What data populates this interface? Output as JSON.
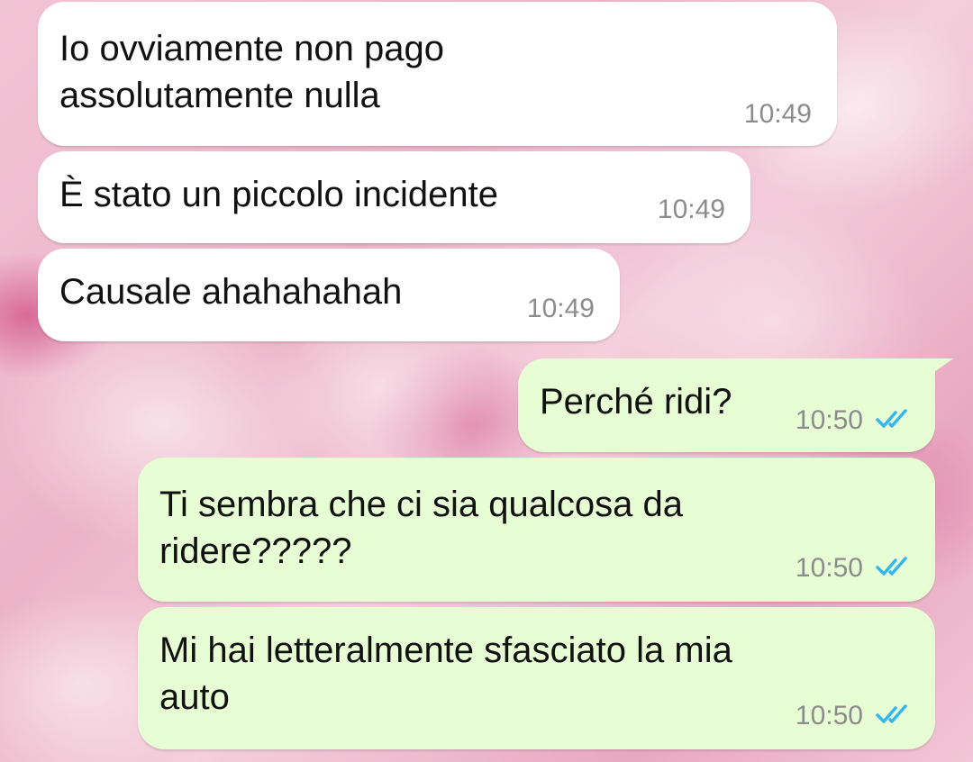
{
  "chat": {
    "messages": [
      {
        "direction": "incoming",
        "lines": [
          "Io ovviamente non pago",
          "assolutamente nulla"
        ],
        "time": "10:49"
      },
      {
        "direction": "incoming",
        "lines": [
          "È stato un piccolo incidente"
        ],
        "time": "10:49"
      },
      {
        "direction": "incoming",
        "lines": [
          "Causale ahahahahah"
        ],
        "time": "10:49"
      },
      {
        "direction": "outgoing",
        "lines": [
          "Perché ridi?"
        ],
        "time": "10:50",
        "status": "read"
      },
      {
        "direction": "outgoing",
        "lines": [
          "Ti sembra che ci sia qualcosa da",
          "ridere?????"
        ],
        "time": "10:50",
        "status": "read"
      },
      {
        "direction": "outgoing",
        "lines": [
          "Mi hai letteralmente sfasciato la mia",
          "auto"
        ],
        "time": "10:50",
        "status": "read"
      }
    ]
  },
  "colors": {
    "incoming_bubble": "#ffffff",
    "outgoing_bubble": "#e7fdd4",
    "read_ticks": "#34b7f1",
    "timestamp": "#8c8c8c"
  },
  "icons": {
    "read_status": "double-check-icon"
  }
}
